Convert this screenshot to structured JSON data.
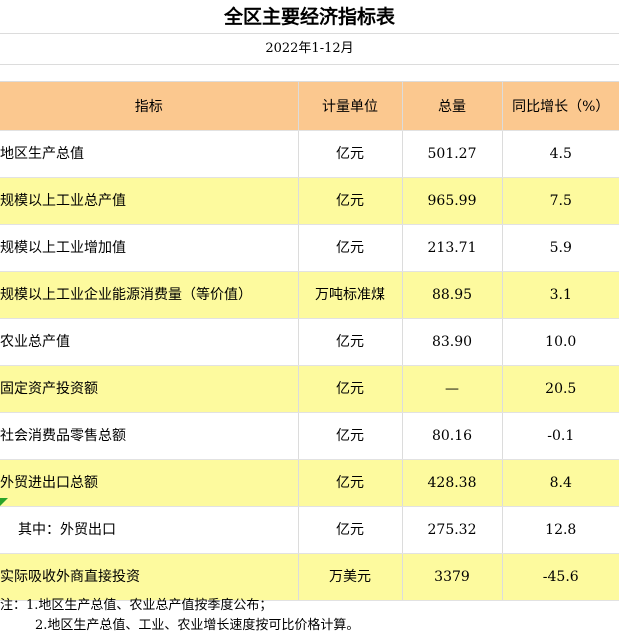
{
  "title": "全区主要经济指标表",
  "subtitle": "2022年1-12月",
  "headers": [
    "指标",
    "计量单位",
    "总量",
    "同比增长（%）"
  ],
  "rows": [
    {
      "name": "地区生产总值",
      "unit": "亿元",
      "total": "501.27",
      "growth": "4.5"
    },
    {
      "name": "规模以上工业总产值",
      "unit": "亿元",
      "total": "965.99",
      "growth": "7.5"
    },
    {
      "name": "规模以上工业增加值",
      "unit": "亿元",
      "total": "213.71",
      "growth": "5.9"
    },
    {
      "name": "规模以上工业企业能源消费量（等价值）",
      "unit": "万吨标准煤",
      "total": "88.95",
      "growth": "3.1"
    },
    {
      "name": "农业总产值",
      "unit": "亿元",
      "total": "83.90",
      "growth": "10.0"
    },
    {
      "name": "固定资产投资额",
      "unit": "亿元",
      "total": "—",
      "growth": "20.5"
    },
    {
      "name": "社会消费品零售总额",
      "unit": "亿元",
      "total": "80.16",
      "growth": "-0.1"
    },
    {
      "name": "外贸进出口总额",
      "unit": "亿元",
      "total": "428.38",
      "growth": "8.4"
    },
    {
      "name": "其中：外贸出口",
      "unit": "亿元",
      "total": "275.32",
      "growth": "12.8"
    },
    {
      "name": "实际吸收外商直接投资",
      "unit": "万美元",
      "total": "3379",
      "growth": "-45.6"
    }
  ],
  "notes": {
    "line1": "注：1.地区生产总值、农业总产值按季度公布；",
    "line2": "2.地区生产总值、工业、农业增长速度按可比价格计算。"
  }
}
